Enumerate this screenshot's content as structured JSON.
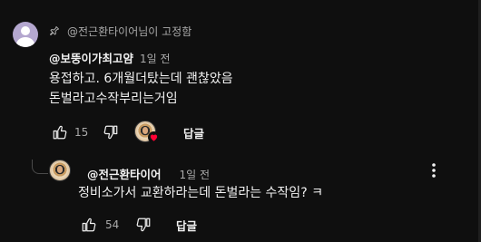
{
  "pinned": {
    "label": "@전근환타이어님이 고정함"
  },
  "comment": {
    "author": "@보뚱이가최고얌",
    "time": "1일 전",
    "text_line1": "용접하고. 6개월더탔는데 괜찮았음",
    "text_line2": "돈벌라고수작부리는거임",
    "like_count": "15",
    "reply_label": "답글"
  },
  "reply": {
    "author": "@전근환타이어",
    "time": "1일 전",
    "text": "정비소가서 교환하라는데 돈벌라는 수작임? ㅋ",
    "like_count": "54",
    "reply_label": "답글"
  },
  "colors": {
    "background": "#0f0f0f",
    "text": "#f1f1f1",
    "muted": "#aaaaaa",
    "heart": "#ff0033"
  },
  "icons": [
    "pin-icon",
    "thumb-up-icon",
    "thumb-down-icon",
    "heart-icon",
    "more-vert-icon"
  ]
}
